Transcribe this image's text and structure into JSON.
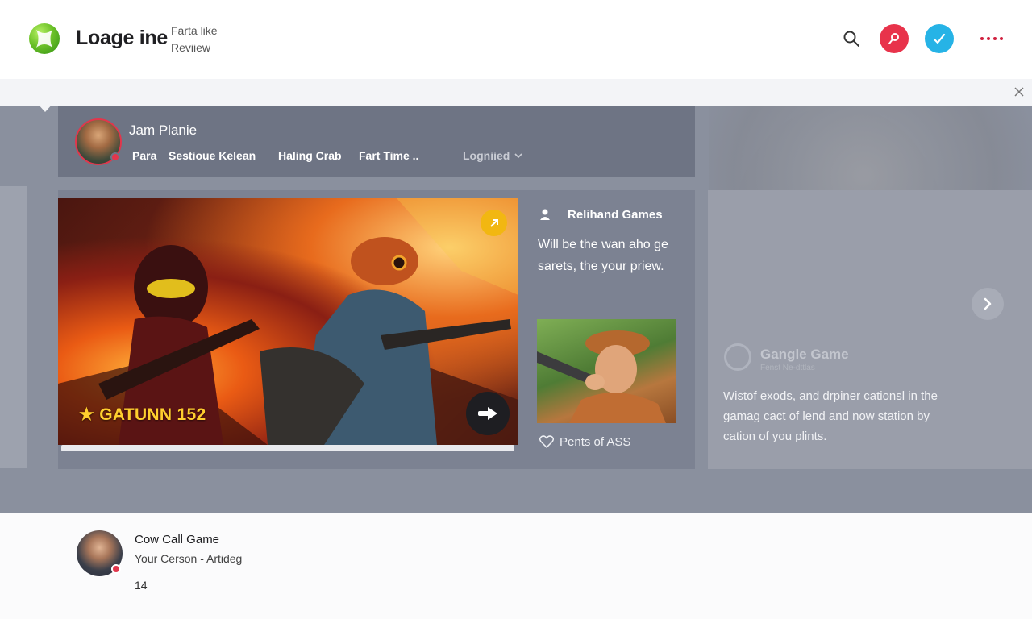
{
  "header": {
    "brand": "Loage ine",
    "brand_sub_1": "Farta like",
    "brand_sub_2": "Reviiew",
    "icons": [
      "search-icon",
      "key-icon",
      "check-icon",
      "more-icon"
    ],
    "colors": {
      "key": "#e8334b",
      "check": "#26b3e6",
      "more": "#d0213f"
    }
  },
  "profile": {
    "name": "Jam Planie",
    "tabs": [
      "Para",
      "Sestioue Kelean",
      "Haling Crab",
      "Fart Time .."
    ],
    "dropdown": "Logniied"
  },
  "hero": {
    "title": "GATUNN 152",
    "star": "★"
  },
  "info": {
    "title": "Relihand Games",
    "description": "Will be the wan aho ge sarets, the your priew.",
    "like_text": "Pents of ASS"
  },
  "side": {
    "title": "Gangle Game",
    "subtitle": "Fenst Ne-dttlas",
    "description": "Wistof exods, and drpiner cationsl in the gamag cact of lend and now station by cation of you plints."
  },
  "post": {
    "title": "Cow Call Game",
    "subtitle": "Your Cerson - Artideg",
    "count": "14"
  }
}
